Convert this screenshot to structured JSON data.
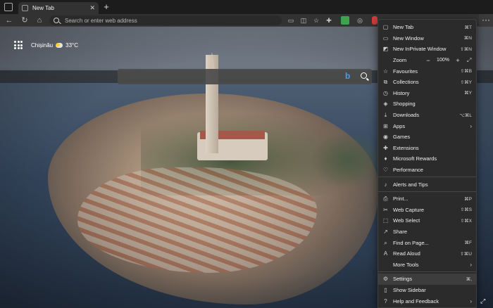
{
  "tab": {
    "title": "New Tab",
    "close": "✕",
    "new_tab": "+"
  },
  "toolbar": {
    "back": "←",
    "refresh": "↻",
    "home": "⌂",
    "address_placeholder": "Search or enter web address",
    "more": "···"
  },
  "newtab": {
    "location": "Chișinău",
    "temperature": "33°C",
    "bing": "b"
  },
  "menu": {
    "items": [
      {
        "icon": "new-tab-icon",
        "glyph": "▢",
        "label": "New Tab",
        "shortcut": "⌘T"
      },
      {
        "icon": "new-window-icon",
        "glyph": "▭",
        "label": "New Window",
        "shortcut": "⌘N"
      },
      {
        "icon": "inprivate-icon",
        "glyph": "◩",
        "label": "New InPrivate Window",
        "shortcut": "⇧⌘N"
      },
      {
        "type": "zoom",
        "label": "Zoom",
        "minus": "−",
        "value": "100%",
        "plus": "+",
        "fullscreen": "⤢"
      },
      {
        "icon": "favorites-icon",
        "glyph": "☆",
        "label": "Favourites",
        "shortcut": "⇧⌘B"
      },
      {
        "icon": "collections-icon",
        "glyph": "⧉",
        "label": "Collections",
        "shortcut": "⇧⌘Y"
      },
      {
        "icon": "history-icon",
        "glyph": "◷",
        "label": "History",
        "shortcut": "⌘Y"
      },
      {
        "icon": "shopping-icon",
        "glyph": "◈",
        "label": "Shopping",
        "shortcut": ""
      },
      {
        "icon": "downloads-icon",
        "glyph": "⤓",
        "label": "Downloads",
        "shortcut": "⌥⌘L"
      },
      {
        "icon": "apps-icon",
        "glyph": "⊞",
        "label": "Apps",
        "shortcut": "",
        "arrow": "›"
      },
      {
        "icon": "games-icon",
        "glyph": "◉",
        "label": "Games",
        "shortcut": ""
      },
      {
        "icon": "extensions-icon",
        "glyph": "✚",
        "label": "Extensions",
        "shortcut": ""
      },
      {
        "icon": "rewards-icon",
        "glyph": "♦",
        "label": "Microsoft Rewards",
        "shortcut": ""
      },
      {
        "icon": "performance-icon",
        "glyph": "♡",
        "label": "Performance",
        "shortcut": ""
      },
      {
        "type": "sep"
      },
      {
        "icon": "bell-icon",
        "glyph": "♪",
        "label": "Alerts and Tips",
        "shortcut": ""
      },
      {
        "type": "sep"
      },
      {
        "icon": "print-icon",
        "glyph": "⎙",
        "label": "Print...",
        "shortcut": "⌘P"
      },
      {
        "icon": "web-capture-icon",
        "glyph": "✂",
        "label": "Web Capture",
        "shortcut": "⇧⌘S"
      },
      {
        "icon": "web-select-icon",
        "glyph": "⬚",
        "label": "Web Select",
        "shortcut": "⇧⌘X"
      },
      {
        "icon": "share-icon",
        "glyph": "↗",
        "label": "Share",
        "shortcut": ""
      },
      {
        "icon": "find-icon",
        "glyph": "⌕",
        "label": "Find on Page...",
        "shortcut": "⌘F"
      },
      {
        "icon": "read-aloud-icon",
        "glyph": "A",
        "label": "Read Aloud",
        "shortcut": "⇧⌘U"
      },
      {
        "icon": "more-tools-icon",
        "glyph": "",
        "label": "More Tools",
        "shortcut": "",
        "arrow": "›"
      },
      {
        "type": "sep"
      },
      {
        "icon": "gear-icon",
        "glyph": "⚙",
        "label": "Settings",
        "shortcut": "⌘,",
        "highlighted": true
      },
      {
        "icon": "sidebar-icon",
        "glyph": "▯",
        "label": "Show Sidebar",
        "shortcut": ""
      },
      {
        "icon": "help-icon",
        "glyph": "?",
        "label": "Help and Feedback",
        "shortcut": "",
        "arrow": "›"
      }
    ]
  },
  "colors": {
    "chrome_bg": "#1c1c1c",
    "toolbar_bg": "#323232",
    "menu_bg": "#2b2b2b",
    "menu_highlight": "#3d3d3d",
    "bing_blue": "#3ba0ff"
  }
}
